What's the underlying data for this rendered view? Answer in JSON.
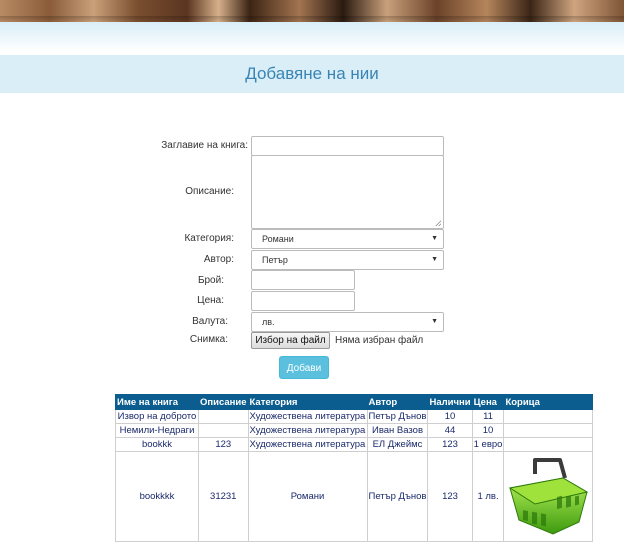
{
  "page": {
    "title": "Добавяне на нии"
  },
  "form": {
    "title_label": "Заглавие на книга:",
    "title_value": "",
    "description_label": "Описание:",
    "description_value": "",
    "category_label": "Категория:",
    "category_value": "Романи",
    "author_label": "Автор:",
    "author_value": "Петър",
    "count_label": "Брой:",
    "count_value": "",
    "price_label": "Цена:",
    "price_value": "",
    "currency_label": "Валута:",
    "currency_value": "лв.",
    "image_label": "Снимка:",
    "file_button": "Избор на файл",
    "file_status": "Няма избран файл",
    "submit_label": "Добави"
  },
  "table": {
    "headers": [
      "Име на книга",
      "Описание",
      "Категория",
      "Автор",
      "Налични",
      "Цена",
      "Корица"
    ],
    "rows": [
      {
        "name": "Извор на доброто",
        "description": "",
        "category": "Художествена литература",
        "author": "Петър Дънов",
        "available": "10",
        "price": "11",
        "cover": ""
      },
      {
        "name": "Немили-Недраги",
        "description": "",
        "category": "Художествена литература",
        "author": "Иван Вазов",
        "available": "44",
        "price": "10",
        "cover": ""
      },
      {
        "name": "bookkk",
        "description": "123",
        "category": "Художествена литература",
        "author": "ЕЛ Джеймс",
        "available": "123",
        "price": "1 евро",
        "cover": ""
      },
      {
        "name": "bookkkk",
        "description": "31231",
        "category": "Романи",
        "author": "Петър Дънов",
        "available": "123",
        "price": "1 лв.",
        "cover": "shopping-basket-icon"
      }
    ]
  },
  "colors": {
    "title_bar_bg": "#d9eef7",
    "title_text": "#3a84b4",
    "table_header_bg": "#0a5d8e",
    "submit_button": "#5bc0de"
  }
}
